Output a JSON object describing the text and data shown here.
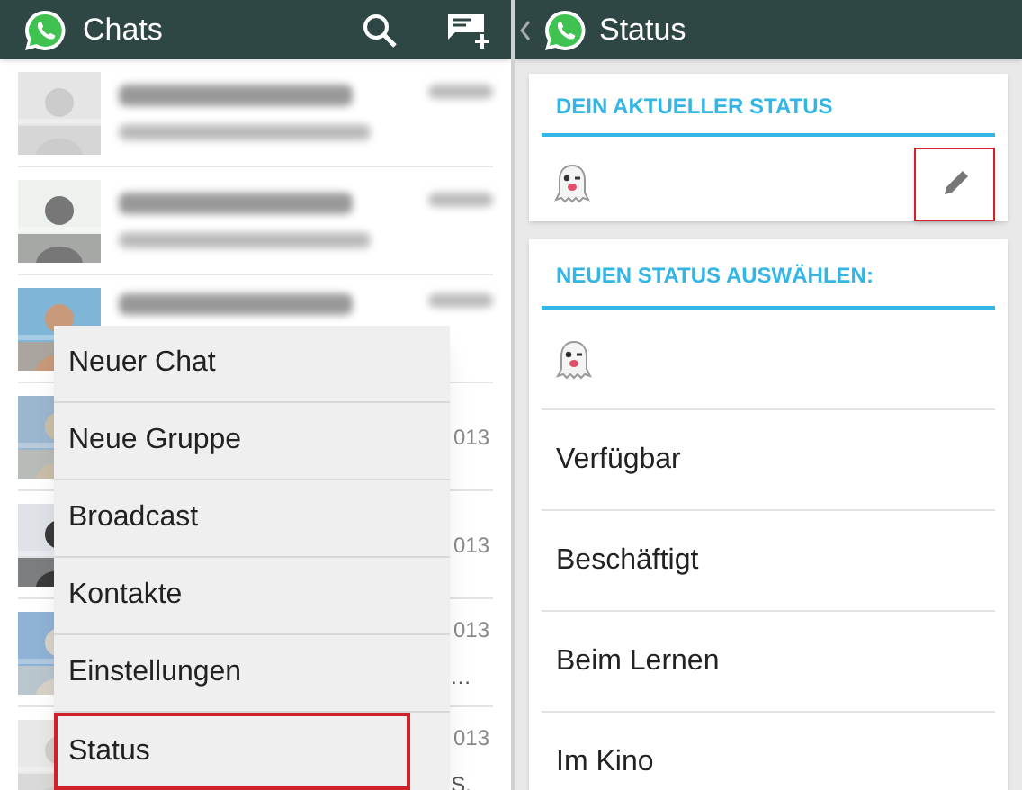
{
  "chats_screen": {
    "title": "Chats",
    "chats": [
      {
        "kind": "blurred"
      },
      {
        "kind": "blurred"
      },
      {
        "kind": "blurred_top"
      },
      {
        "kind": "partial",
        "date": "013"
      },
      {
        "kind": "partial",
        "date": "013"
      },
      {
        "kind": "partial",
        "date": "013",
        "preview": "…"
      },
      {
        "kind": "partial",
        "date": "013",
        "preview": "S."
      }
    ],
    "menu": [
      {
        "label": "Neuer Chat",
        "highlighted": false
      },
      {
        "label": "Neue Gruppe",
        "highlighted": false
      },
      {
        "label": "Broadcast",
        "highlighted": false
      },
      {
        "label": "Kontakte",
        "highlighted": false
      },
      {
        "label": "Einstellungen",
        "highlighted": false
      },
      {
        "label": "Status",
        "highlighted": true
      }
    ]
  },
  "status_screen": {
    "title": "Status",
    "current": {
      "heading": "DEIN AKTUELLER STATUS",
      "edit_highlighted": true
    },
    "choose": {
      "heading": "NEUEN STATUS AUSWÄHLEN:",
      "options": [
        {
          "kind": "emoji"
        },
        {
          "kind": "text",
          "label": "Verfügbar"
        },
        {
          "kind": "text",
          "label": "Beschäftigt"
        },
        {
          "kind": "text",
          "label": "Beim Lernen"
        },
        {
          "kind": "text",
          "label": "Im Kino"
        }
      ]
    }
  }
}
